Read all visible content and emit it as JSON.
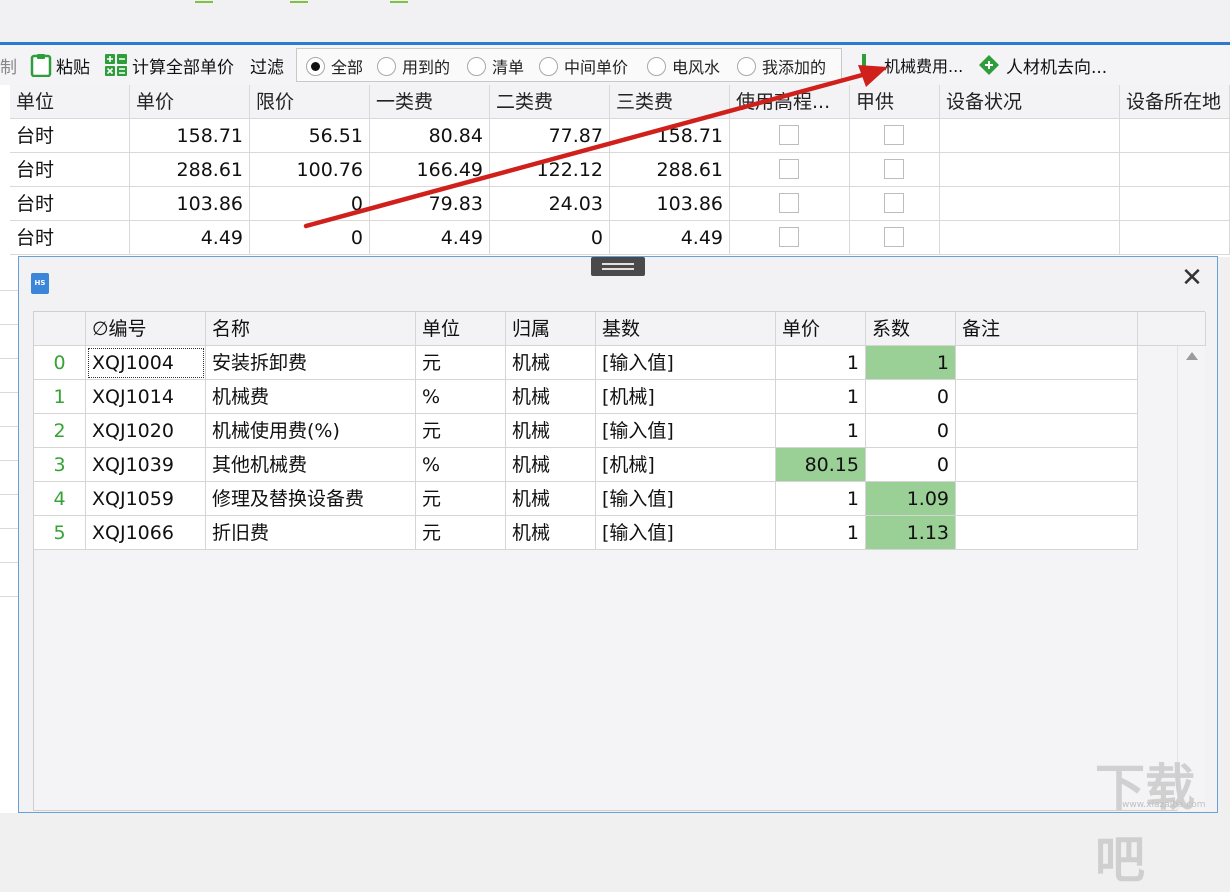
{
  "toolbar": {
    "copy_partial": "制",
    "paste": "粘贴",
    "calc_all": "计算全部单价",
    "filter_label": "过滤",
    "filter_options": [
      {
        "label": "全部",
        "checked": true
      },
      {
        "label": "用到的",
        "checked": false
      },
      {
        "label": "清单",
        "checked": false
      },
      {
        "label": "中间单价",
        "checked": false
      },
      {
        "label": "电风水",
        "checked": false
      },
      {
        "label": "我添加的",
        "checked": false
      }
    ],
    "machine_fee": "机械费用...",
    "labor_flow": "人材机去向..."
  },
  "main_grid": {
    "headers": [
      "单位",
      "单价",
      "限价",
      "一类费",
      "二类费",
      "三类费",
      "使用高程...",
      "甲供",
      "设备状况",
      "设备所在地"
    ],
    "rows": [
      [
        "台时",
        "158.71",
        "56.51",
        "80.84",
        "77.87",
        "158.71"
      ],
      [
        "台时",
        "288.61",
        "100.76",
        "166.49",
        "122.12",
        "288.61"
      ],
      [
        "台时",
        "103.86",
        "0",
        "79.83",
        "24.03",
        "103.86"
      ],
      [
        "台时",
        "4.49",
        "0",
        "4.49",
        "0",
        "4.49"
      ]
    ]
  },
  "dialog": {
    "icon_text": "HS",
    "headers": [
      "∅编号",
      "名称",
      "单位",
      "归属",
      "基数",
      "单价",
      "系数",
      "备注"
    ],
    "rows": [
      {
        "idx": "0",
        "code": "XQJ1004",
        "name": "安装拆卸费",
        "unit": "元",
        "belong": "机械",
        "base": "[输入值]",
        "price": "1",
        "coef": "1",
        "note": "",
        "price_hl": false,
        "coef_hl": true
      },
      {
        "idx": "1",
        "code": "XQJ1014",
        "name": "机械费",
        "unit": "%",
        "belong": "机械",
        "base": "[机械]",
        "price": "1",
        "coef": "0",
        "note": "",
        "price_hl": false,
        "coef_hl": false
      },
      {
        "idx": "2",
        "code": "XQJ1020",
        "name": "机械使用费(%)",
        "unit": "元",
        "belong": "机械",
        "base": "[输入值]",
        "price": "1",
        "coef": "0",
        "note": "",
        "price_hl": false,
        "coef_hl": false
      },
      {
        "idx": "3",
        "code": "XQJ1039",
        "name": "其他机械费",
        "unit": "%",
        "belong": "机械",
        "base": "[机械]",
        "price": "80.15",
        "coef": "0",
        "note": "",
        "price_hl": true,
        "coef_hl": false
      },
      {
        "idx": "4",
        "code": "XQJ1059",
        "name": "修理及替换设备费",
        "unit": "元",
        "belong": "机械",
        "base": "[输入值]",
        "price": "1",
        "coef": "1.09",
        "note": "",
        "price_hl": false,
        "coef_hl": true
      },
      {
        "idx": "5",
        "code": "XQJ1066",
        "name": "折旧费",
        "unit": "元",
        "belong": "机械",
        "base": "[输入值]",
        "price": "1",
        "coef": "1.13",
        "note": "",
        "price_hl": false,
        "coef_hl": true
      }
    ]
  },
  "colors": {
    "accent": "#2a7ad2",
    "highlight": "#9acf96",
    "arrow": "#d0201c",
    "index_green": "#36a336"
  }
}
